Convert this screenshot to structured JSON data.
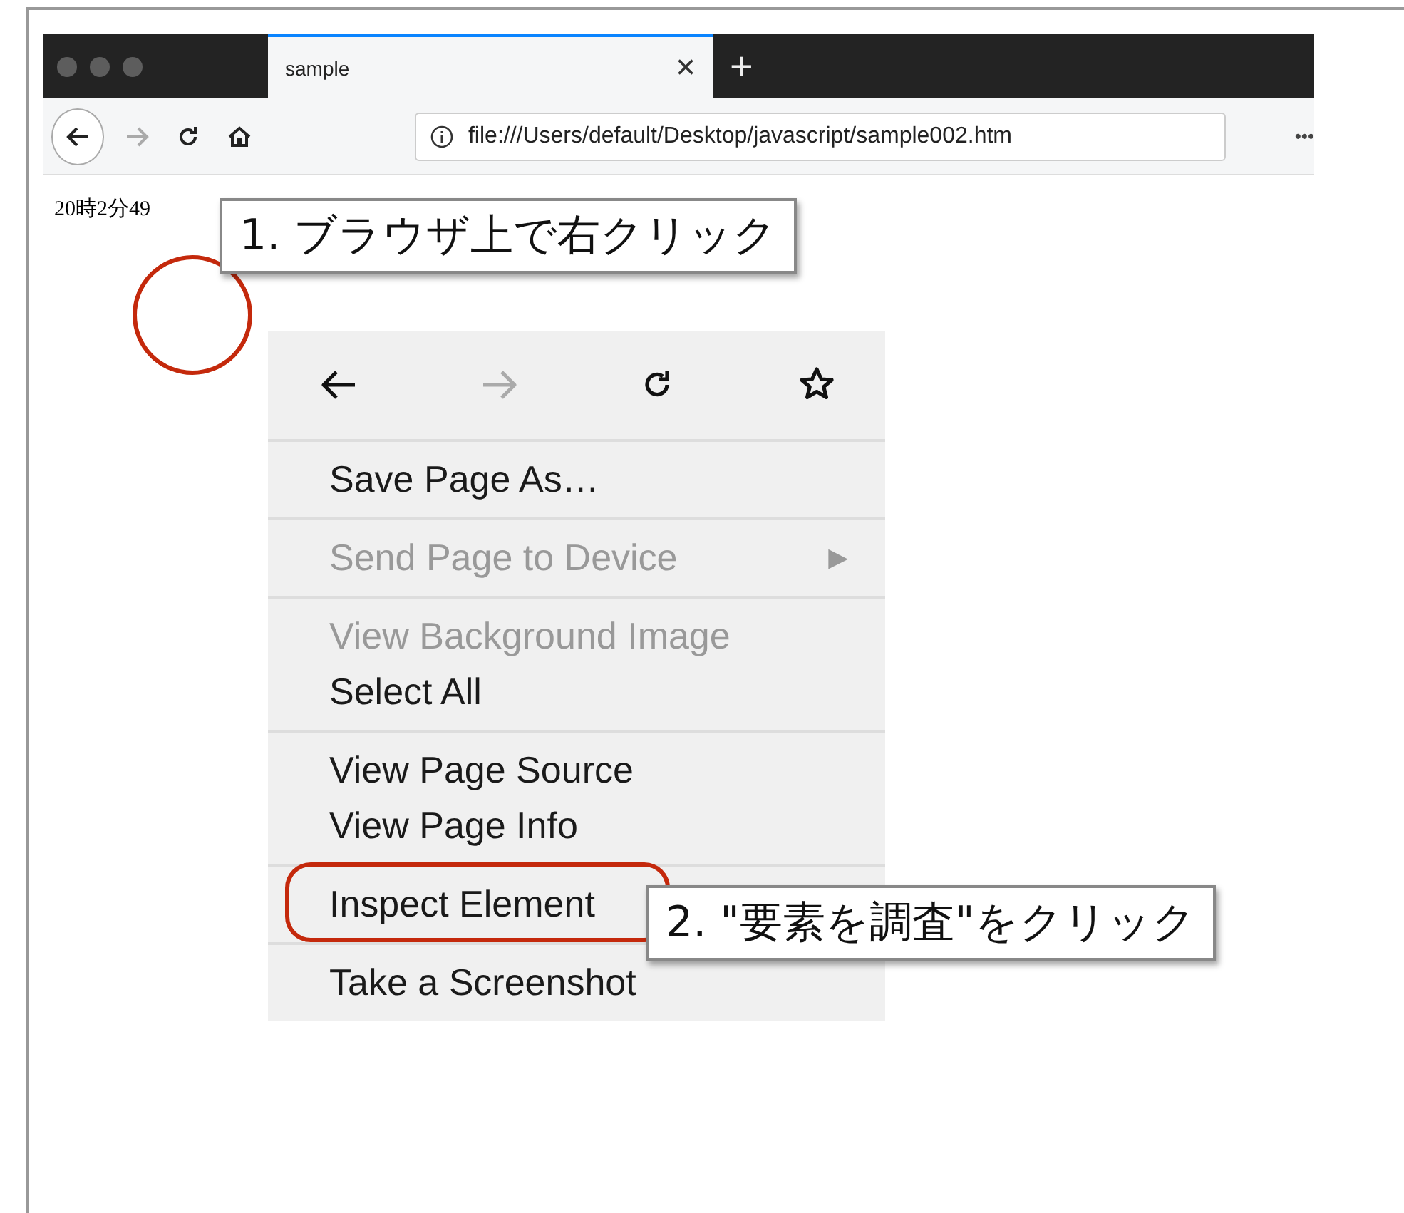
{
  "browser": {
    "tab": {
      "title": "sample",
      "close": "×"
    },
    "new_tab": "+",
    "address": "file:///Users/default/Desktop/javascript/sample002.htm",
    "nav": [
      {
        "kind": "back",
        "disabled": false
      },
      {
        "kind": "forward",
        "disabled": true
      },
      {
        "kind": "reload",
        "disabled": false
      },
      {
        "kind": "home",
        "disabled": false
      }
    ],
    "more": "•••"
  },
  "page": {
    "text": "20時2分49"
  },
  "context_menu": {
    "nav": [
      {
        "kind": "back",
        "disabled": false
      },
      {
        "kind": "forward",
        "disabled": true
      },
      {
        "kind": "reload",
        "disabled": false
      },
      {
        "kind": "bookmark",
        "disabled": false
      }
    ],
    "groups": [
      [
        {
          "label": "Save Page As…",
          "disabled": false
        }
      ],
      [
        {
          "label": "Send Page to Device",
          "disabled": true,
          "submenu": "▶"
        }
      ],
      [
        {
          "label": "View Background Image",
          "disabled": true
        },
        {
          "label": "Select All",
          "disabled": false
        }
      ],
      [
        {
          "label": "View Page Source",
          "disabled": false
        },
        {
          "label": "View Page Info",
          "disabled": false
        }
      ],
      [
        {
          "label": "Inspect Element",
          "disabled": false,
          "highlighted": true
        }
      ],
      [
        {
          "label": "Take a Screenshot",
          "disabled": false
        }
      ]
    ]
  },
  "callouts": [
    "1. ブラウザ上で右クリック",
    "2. \"要素を調査\"をクリック"
  ]
}
